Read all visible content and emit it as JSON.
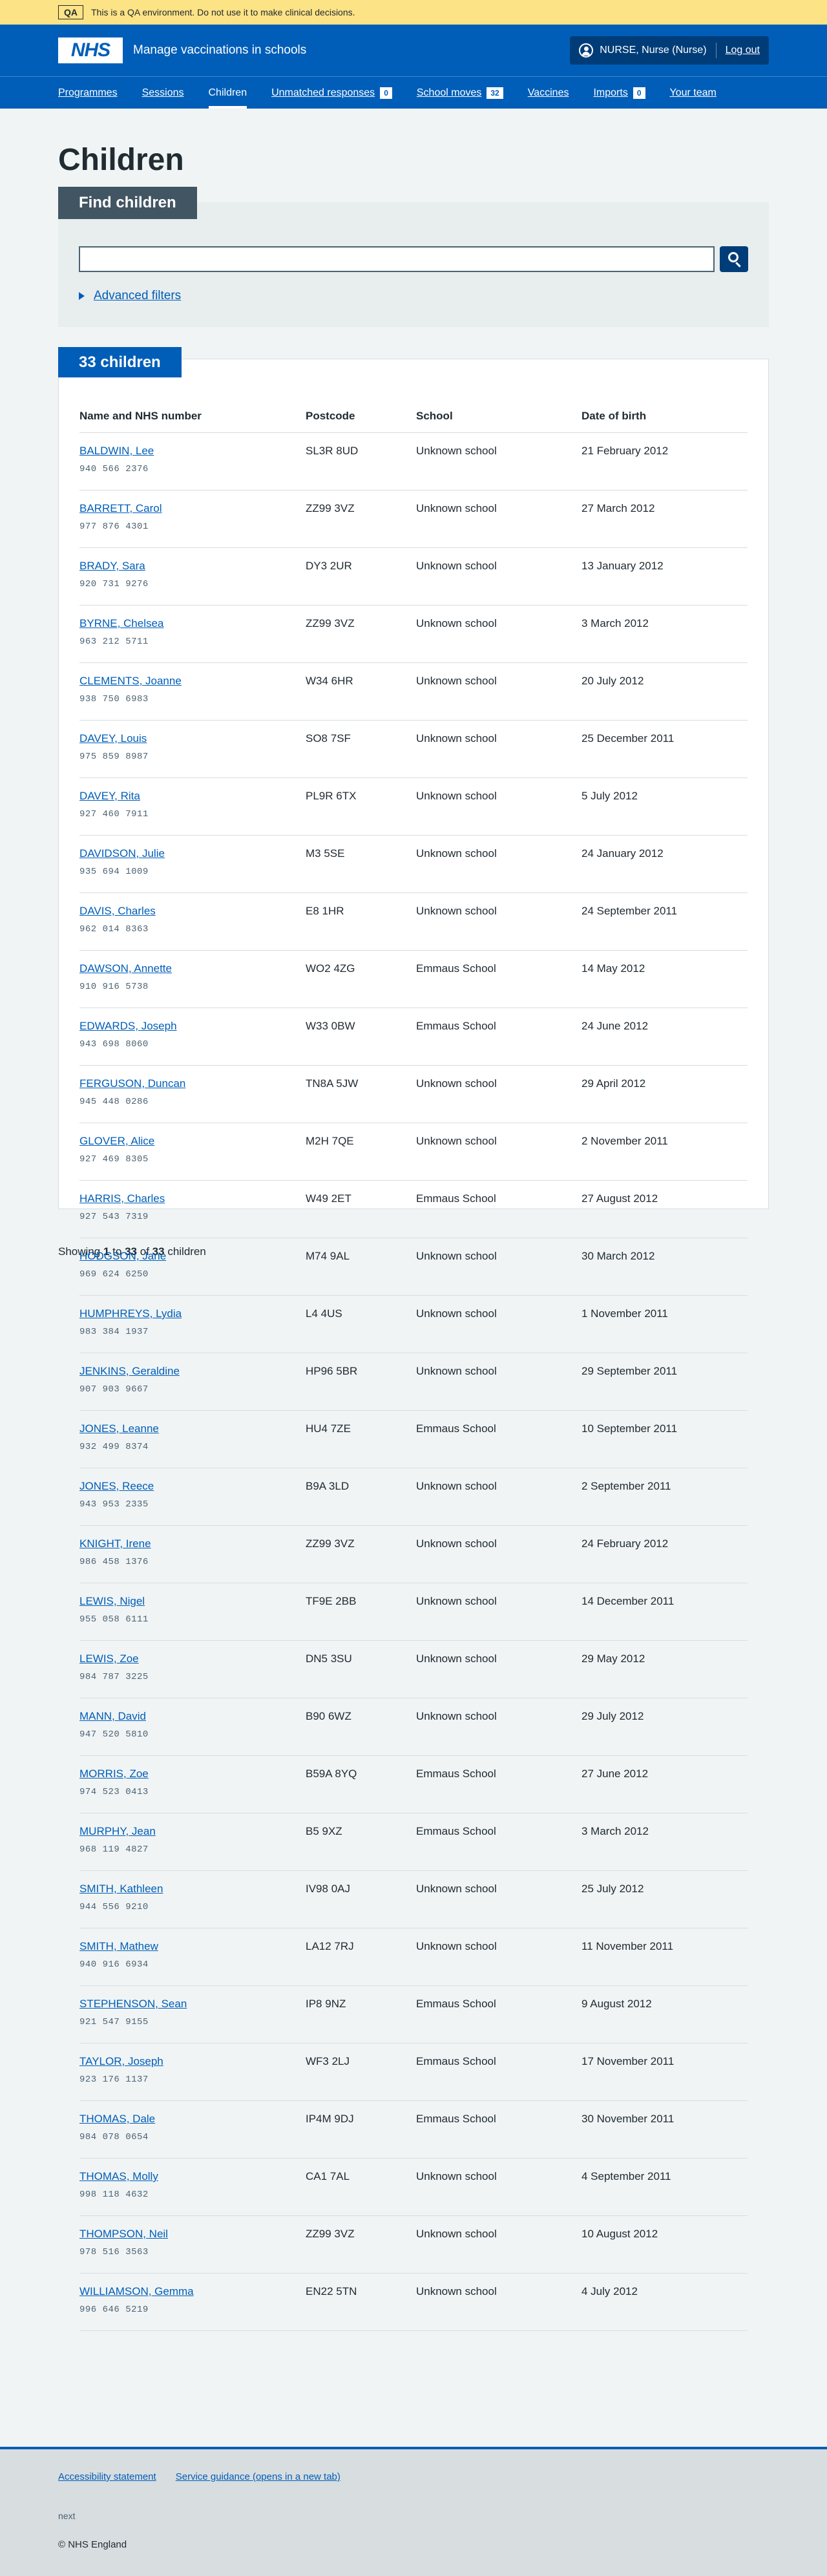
{
  "qa_banner": {
    "tag": "QA",
    "text": "This is a QA environment. Do not use it to make clinical decisions."
  },
  "header": {
    "logo": "NHS",
    "service_name": "Manage vaccinations in schools",
    "account_name": "NURSE, Nurse (Nurse)",
    "logout": "Log out"
  },
  "nav": {
    "programmes": "Programmes",
    "sessions": "Sessions",
    "children": "Children",
    "unmatched": "Unmatched responses",
    "unmatched_count": "0",
    "school_moves": "School moves",
    "school_moves_count": "32",
    "vaccines": "Vaccines",
    "imports": "Imports",
    "imports_count": "0",
    "your_team": "Your team"
  },
  "page_title": "Children",
  "find": {
    "heading": "Find children",
    "search_value": "",
    "advanced_filters": "Advanced filters"
  },
  "results": {
    "heading": "33 children",
    "columns": [
      "Name and NHS number",
      "Postcode",
      "School",
      "Date of birth"
    ],
    "rows": [
      {
        "name": "BALDWIN, Lee",
        "nhs": "940 566 2376",
        "postcode": "SL3R 8UD",
        "school": "Unknown school",
        "dob": "21 February 2012"
      },
      {
        "name": "BARRETT, Carol",
        "nhs": "977 876 4301",
        "postcode": "ZZ99 3VZ",
        "school": "Unknown school",
        "dob": "27 March 2012"
      },
      {
        "name": "BRADY, Sara",
        "nhs": "920 731 9276",
        "postcode": "DY3 2UR",
        "school": "Unknown school",
        "dob": "13 January 2012"
      },
      {
        "name": "BYRNE, Chelsea",
        "nhs": "963 212 5711",
        "postcode": "ZZ99 3VZ",
        "school": "Unknown school",
        "dob": "3 March 2012"
      },
      {
        "name": "CLEMENTS, Joanne",
        "nhs": "938 750 6983",
        "postcode": "W34 6HR",
        "school": "Unknown school",
        "dob": "20 July 2012"
      },
      {
        "name": "DAVEY, Louis",
        "nhs": "975 859 8987",
        "postcode": "SO8 7SF",
        "school": "Unknown school",
        "dob": "25 December 2011"
      },
      {
        "name": "DAVEY, Rita",
        "nhs": "927 460 7911",
        "postcode": "PL9R 6TX",
        "school": "Unknown school",
        "dob": "5 July 2012"
      },
      {
        "name": "DAVIDSON, Julie",
        "nhs": "935 694 1009",
        "postcode": "M3 5SE",
        "school": "Unknown school",
        "dob": "24 January 2012"
      },
      {
        "name": "DAVIS, Charles",
        "nhs": "962 014 8363",
        "postcode": "E8 1HR",
        "school": "Unknown school",
        "dob": "24 September 2011"
      },
      {
        "name": "DAWSON, Annette",
        "nhs": "910 916 5738",
        "postcode": "WO2 4ZG",
        "school": "Emmaus School",
        "dob": "14 May 2012"
      },
      {
        "name": "EDWARDS, Joseph",
        "nhs": "943 698 8060",
        "postcode": "W33 0BW",
        "school": "Emmaus School",
        "dob": "24 June 2012"
      },
      {
        "name": "FERGUSON, Duncan",
        "nhs": "945 448 0286",
        "postcode": "TN8A 5JW",
        "school": "Unknown school",
        "dob": "29 April 2012"
      },
      {
        "name": "GLOVER, Alice",
        "nhs": "927 469 8305",
        "postcode": "M2H 7QE",
        "school": "Unknown school",
        "dob": "2 November 2011"
      },
      {
        "name": "HARRIS, Charles",
        "nhs": "927 543 7319",
        "postcode": "W49 2ET",
        "school": "Emmaus School",
        "dob": "27 August 2012"
      },
      {
        "name": "HODGSON, Jane",
        "nhs": "969 624 6250",
        "postcode": "M74 9AL",
        "school": "Unknown school",
        "dob": "30 March 2012"
      },
      {
        "name": "HUMPHREYS, Lydia",
        "nhs": "983 384 1937",
        "postcode": "L4 4US",
        "school": "Unknown school",
        "dob": "1 November 2011"
      },
      {
        "name": "JENKINS, Geraldine",
        "nhs": "907 903 9667",
        "postcode": "HP96 5BR",
        "school": "Unknown school",
        "dob": "29 September 2011"
      },
      {
        "name": "JONES, Leanne",
        "nhs": "932 499 8374",
        "postcode": "HU4 7ZE",
        "school": "Emmaus School",
        "dob": "10 September 2011"
      },
      {
        "name": "JONES, Reece",
        "nhs": "943 953 2335",
        "postcode": "B9A 3LD",
        "school": "Unknown school",
        "dob": "2 September 2011"
      },
      {
        "name": "KNIGHT, Irene",
        "nhs": "986 458 1376",
        "postcode": "ZZ99 3VZ",
        "school": "Unknown school",
        "dob": "24 February 2012"
      },
      {
        "name": "LEWIS, Nigel",
        "nhs": "955 058 6111",
        "postcode": "TF9E 2BB",
        "school": "Unknown school",
        "dob": "14 December 2011"
      },
      {
        "name": "LEWIS, Zoe",
        "nhs": "984 787 3225",
        "postcode": "DN5 3SU",
        "school": "Unknown school",
        "dob": "29 May 2012"
      },
      {
        "name": "MANN, David",
        "nhs": "947 520 5810",
        "postcode": "B90 6WZ",
        "school": "Unknown school",
        "dob": "29 July 2012"
      },
      {
        "name": "MORRIS, Zoe",
        "nhs": "974 523 0413",
        "postcode": "B59A 8YQ",
        "school": "Emmaus School",
        "dob": "27 June 2012"
      },
      {
        "name": "MURPHY, Jean",
        "nhs": "968 119 4827",
        "postcode": "B5 9XZ",
        "school": "Emmaus School",
        "dob": "3 March 2012"
      },
      {
        "name": "SMITH, Kathleen",
        "nhs": "944 556 9210",
        "postcode": "IV98 0AJ",
        "school": "Unknown school",
        "dob": "25 July 2012"
      },
      {
        "name": "SMITH, Mathew",
        "nhs": "940 916 6934",
        "postcode": "LA12 7RJ",
        "school": "Unknown school",
        "dob": "11 November 2011"
      },
      {
        "name": "STEPHENSON, Sean",
        "nhs": "921 547 9155",
        "postcode": "IP8 9NZ",
        "school": "Emmaus School",
        "dob": "9 August 2012"
      },
      {
        "name": "TAYLOR, Joseph",
        "nhs": "923 176 1137",
        "postcode": "WF3 2LJ",
        "school": "Emmaus School",
        "dob": "17 November 2011"
      },
      {
        "name": "THOMAS, Dale",
        "nhs": "984 078 0654",
        "postcode": "IP4M 9DJ",
        "school": "Emmaus School",
        "dob": "30 November 2011"
      },
      {
        "name": "THOMAS, Molly",
        "nhs": "998 118 4632",
        "postcode": "CA1 7AL",
        "school": "Unknown school",
        "dob": "4 September 2011"
      },
      {
        "name": "THOMPSON, Neil",
        "nhs": "978 516 3563",
        "postcode": "ZZ99 3VZ",
        "school": "Unknown school",
        "dob": "10 August 2012"
      },
      {
        "name": "WILLIAMSON, Gemma",
        "nhs": "996 646 5219",
        "postcode": "EN22 5TN",
        "school": "Unknown school",
        "dob": "4 July 2012"
      }
    ]
  },
  "pagination": {
    "prefix": "Showing",
    "from": "1",
    "to_word": "to",
    "to": "33",
    "of_word": "of",
    "total": "33",
    "suffix": "children"
  },
  "footer": {
    "accessibility": "Accessibility statement",
    "guidance": "Service guidance (opens in a new tab)",
    "version": "next",
    "copyright": "© NHS England"
  }
}
